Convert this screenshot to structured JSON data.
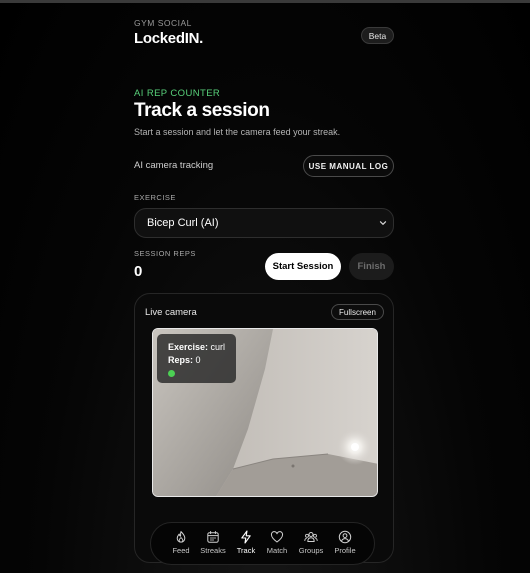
{
  "header": {
    "eyebrow": "GYM SOCIAL",
    "brand_name": "LockedIN",
    "brand_dot": ".",
    "badge": "Beta"
  },
  "intro": {
    "kicker": "AI REP COUNTER",
    "title": "Track a session",
    "subtitle": "Start a session and let the camera feed your streak."
  },
  "mode": {
    "label": "AI camera tracking",
    "manual_button": "USE MANUAL LOG"
  },
  "exercise": {
    "label": "EXERCISE",
    "selected": "Bicep Curl (AI)",
    "chevron_icon": "chevron-down-icon"
  },
  "session": {
    "reps_label": "SESSION REPS",
    "reps_value": "0",
    "start_button": "Start Session",
    "finish_button": "Finish"
  },
  "camera": {
    "title": "Live camera",
    "fullscreen_button": "Fullscreen",
    "overlay": {
      "exercise_key": "Exercise:",
      "exercise_value": " curl",
      "reps_key": "Reps:",
      "reps_value": " 0",
      "status_color": "#4cd054"
    }
  },
  "nav": {
    "items": [
      {
        "label": "Feed",
        "icon": "flame-icon"
      },
      {
        "label": "Streaks",
        "icon": "calendar-icon"
      },
      {
        "label": "Track",
        "icon": "lightning-icon",
        "active": true
      },
      {
        "label": "Match",
        "icon": "heart-icon"
      },
      {
        "label": "Groups",
        "icon": "people-icon"
      },
      {
        "label": "Profile",
        "icon": "user-circle-icon"
      }
    ]
  },
  "colors": {
    "accent_green": "#58d07a",
    "background": "#000000",
    "primary_button": "#ffffff"
  }
}
